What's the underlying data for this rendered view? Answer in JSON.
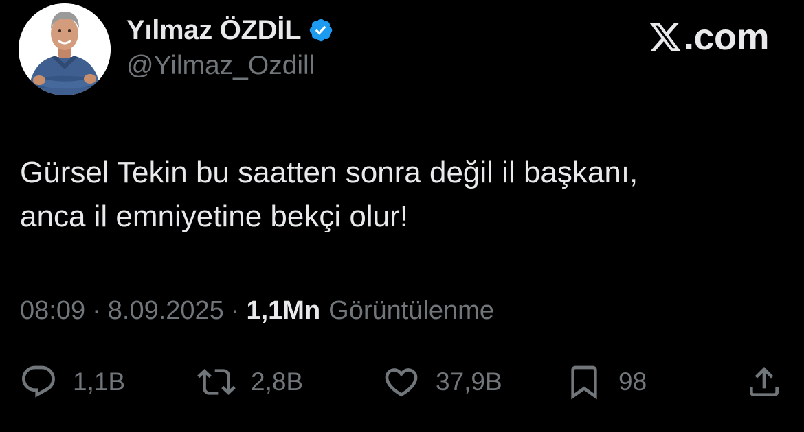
{
  "author": {
    "display_name": "Yılmaz ÖZDİL",
    "handle": "@Yilmaz_Ozdill",
    "verified": true
  },
  "brand": {
    "icon": "x-logo-icon",
    "text": ".com"
  },
  "tweet": {
    "lines": [
      "Gürsel Tekin bu saatten sonra değil il başkanı,",
      "anca il emniyetine bekçi olur!"
    ]
  },
  "meta": {
    "time": "08:09",
    "separator": "·",
    "date": "8.09.2025",
    "views_count": "1,1Mn",
    "views_label": "Görüntülenme"
  },
  "actions": {
    "reply": {
      "icon": "reply-icon",
      "count": "1,1B"
    },
    "retweet": {
      "icon": "retweet-icon",
      "count": "2,8B"
    },
    "like": {
      "icon": "heart-icon",
      "count": "37,9B"
    },
    "bookmark": {
      "icon": "bookmark-icon",
      "count": "98"
    },
    "share": {
      "icon": "share-icon"
    }
  },
  "colors": {
    "background": "#000000",
    "primary_text": "#e7e9ea",
    "secondary_text": "#71767b",
    "verified_badge": "#1d9bf0"
  }
}
